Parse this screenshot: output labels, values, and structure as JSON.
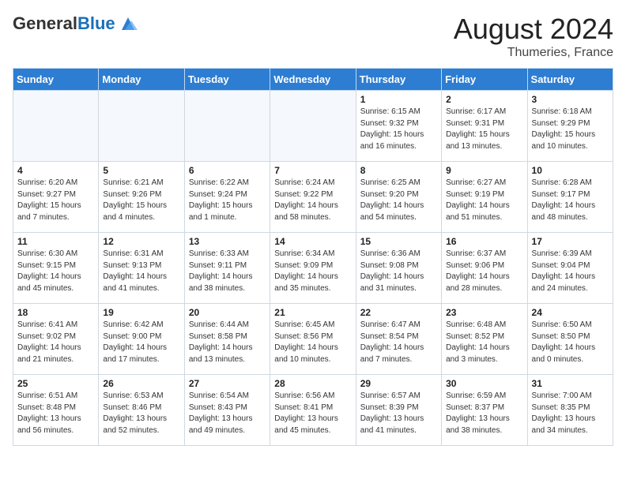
{
  "header": {
    "logo_general": "General",
    "logo_blue": "Blue",
    "month_year": "August 2024",
    "location": "Thumeries, France"
  },
  "weekdays": [
    "Sunday",
    "Monday",
    "Tuesday",
    "Wednesday",
    "Thursday",
    "Friday",
    "Saturday"
  ],
  "weeks": [
    [
      {
        "day": "",
        "info": ""
      },
      {
        "day": "",
        "info": ""
      },
      {
        "day": "",
        "info": ""
      },
      {
        "day": "",
        "info": ""
      },
      {
        "day": "1",
        "info": "Sunrise: 6:15 AM\nSunset: 9:32 PM\nDaylight: 15 hours\nand 16 minutes."
      },
      {
        "day": "2",
        "info": "Sunrise: 6:17 AM\nSunset: 9:31 PM\nDaylight: 15 hours\nand 13 minutes."
      },
      {
        "day": "3",
        "info": "Sunrise: 6:18 AM\nSunset: 9:29 PM\nDaylight: 15 hours\nand 10 minutes."
      }
    ],
    [
      {
        "day": "4",
        "info": "Sunrise: 6:20 AM\nSunset: 9:27 PM\nDaylight: 15 hours\nand 7 minutes."
      },
      {
        "day": "5",
        "info": "Sunrise: 6:21 AM\nSunset: 9:26 PM\nDaylight: 15 hours\nand 4 minutes."
      },
      {
        "day": "6",
        "info": "Sunrise: 6:22 AM\nSunset: 9:24 PM\nDaylight: 15 hours\nand 1 minute."
      },
      {
        "day": "7",
        "info": "Sunrise: 6:24 AM\nSunset: 9:22 PM\nDaylight: 14 hours\nand 58 minutes."
      },
      {
        "day": "8",
        "info": "Sunrise: 6:25 AM\nSunset: 9:20 PM\nDaylight: 14 hours\nand 54 minutes."
      },
      {
        "day": "9",
        "info": "Sunrise: 6:27 AM\nSunset: 9:19 PM\nDaylight: 14 hours\nand 51 minutes."
      },
      {
        "day": "10",
        "info": "Sunrise: 6:28 AM\nSunset: 9:17 PM\nDaylight: 14 hours\nand 48 minutes."
      }
    ],
    [
      {
        "day": "11",
        "info": "Sunrise: 6:30 AM\nSunset: 9:15 PM\nDaylight: 14 hours\nand 45 minutes."
      },
      {
        "day": "12",
        "info": "Sunrise: 6:31 AM\nSunset: 9:13 PM\nDaylight: 14 hours\nand 41 minutes."
      },
      {
        "day": "13",
        "info": "Sunrise: 6:33 AM\nSunset: 9:11 PM\nDaylight: 14 hours\nand 38 minutes."
      },
      {
        "day": "14",
        "info": "Sunrise: 6:34 AM\nSunset: 9:09 PM\nDaylight: 14 hours\nand 35 minutes."
      },
      {
        "day": "15",
        "info": "Sunrise: 6:36 AM\nSunset: 9:08 PM\nDaylight: 14 hours\nand 31 minutes."
      },
      {
        "day": "16",
        "info": "Sunrise: 6:37 AM\nSunset: 9:06 PM\nDaylight: 14 hours\nand 28 minutes."
      },
      {
        "day": "17",
        "info": "Sunrise: 6:39 AM\nSunset: 9:04 PM\nDaylight: 14 hours\nand 24 minutes."
      }
    ],
    [
      {
        "day": "18",
        "info": "Sunrise: 6:41 AM\nSunset: 9:02 PM\nDaylight: 14 hours\nand 21 minutes."
      },
      {
        "day": "19",
        "info": "Sunrise: 6:42 AM\nSunset: 9:00 PM\nDaylight: 14 hours\nand 17 minutes."
      },
      {
        "day": "20",
        "info": "Sunrise: 6:44 AM\nSunset: 8:58 PM\nDaylight: 14 hours\nand 13 minutes."
      },
      {
        "day": "21",
        "info": "Sunrise: 6:45 AM\nSunset: 8:56 PM\nDaylight: 14 hours\nand 10 minutes."
      },
      {
        "day": "22",
        "info": "Sunrise: 6:47 AM\nSunset: 8:54 PM\nDaylight: 14 hours\nand 7 minutes."
      },
      {
        "day": "23",
        "info": "Sunrise: 6:48 AM\nSunset: 8:52 PM\nDaylight: 14 hours\nand 3 minutes."
      },
      {
        "day": "24",
        "info": "Sunrise: 6:50 AM\nSunset: 8:50 PM\nDaylight: 14 hours\nand 0 minutes."
      }
    ],
    [
      {
        "day": "25",
        "info": "Sunrise: 6:51 AM\nSunset: 8:48 PM\nDaylight: 13 hours\nand 56 minutes."
      },
      {
        "day": "26",
        "info": "Sunrise: 6:53 AM\nSunset: 8:46 PM\nDaylight: 13 hours\nand 52 minutes."
      },
      {
        "day": "27",
        "info": "Sunrise: 6:54 AM\nSunset: 8:43 PM\nDaylight: 13 hours\nand 49 minutes."
      },
      {
        "day": "28",
        "info": "Sunrise: 6:56 AM\nSunset: 8:41 PM\nDaylight: 13 hours\nand 45 minutes."
      },
      {
        "day": "29",
        "info": "Sunrise: 6:57 AM\nSunset: 8:39 PM\nDaylight: 13 hours\nand 41 minutes."
      },
      {
        "day": "30",
        "info": "Sunrise: 6:59 AM\nSunset: 8:37 PM\nDaylight: 13 hours\nand 38 minutes."
      },
      {
        "day": "31",
        "info": "Sunrise: 7:00 AM\nSunset: 8:35 PM\nDaylight: 13 hours\nand 34 minutes."
      }
    ]
  ]
}
